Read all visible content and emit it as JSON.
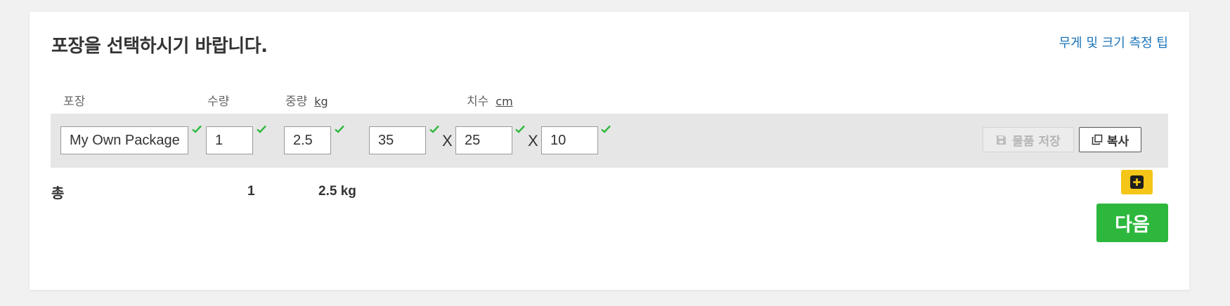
{
  "header": {
    "title": "포장을 선택하시기 바랍니다.",
    "tips_link": "무게 및 크기 측정 팁"
  },
  "columns": {
    "package": "포장",
    "quantity": "수량",
    "weight": "중량",
    "weight_unit": "kg",
    "dimensions": "치수",
    "dimensions_unit": "cm"
  },
  "package_row": {
    "package_value": "My Own Package",
    "quantity_value": "1",
    "weight_value": "2.5",
    "length_value": "35",
    "width_value": "25",
    "height_value": "10",
    "times_symbol": "X",
    "save_label": "물품 저장",
    "copy_label": "복사"
  },
  "totals": {
    "label": "총",
    "quantity": "1",
    "weight": "2.5 kg"
  },
  "actions": {
    "next_label": "다음"
  },
  "icons": {
    "check": "check-icon",
    "save": "floppy-disk-icon",
    "copy": "copy-icon",
    "add": "plus-square-icon"
  },
  "colors": {
    "link": "#1a73b8",
    "valid_check": "#2db83d",
    "add_button": "#f5c518",
    "next_button": "#2db83d",
    "row_background": "#e6e6e6"
  }
}
